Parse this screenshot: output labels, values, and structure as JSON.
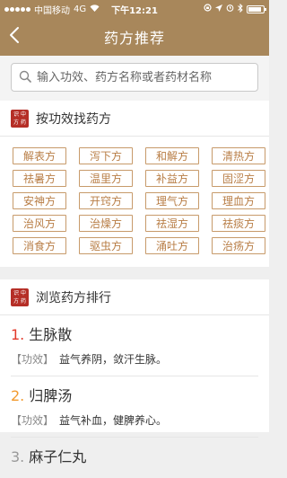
{
  "status_bar": {
    "carrier": "中国移动",
    "network": "4G",
    "time": "下午12:21",
    "battery_level": 0.9
  },
  "nav": {
    "title": "药方推荐",
    "back_icon": "chevron-left-icon"
  },
  "search": {
    "placeholder": "输入功效、药方名称或者药材名称",
    "icon": "search-icon"
  },
  "by_effect": {
    "seal_text": "识中方药",
    "title": "按功效找药方",
    "tags": [
      "解表方",
      "泻下方",
      "和解方",
      "清热方",
      "祛暑方",
      "温里方",
      "补益方",
      "固涩方",
      "安神方",
      "开窍方",
      "理气方",
      "理血方",
      "治风方",
      "治燥方",
      "祛湿方",
      "祛痰方",
      "消食方",
      "驱虫方",
      "涌吐方",
      "治疡方"
    ]
  },
  "ranking": {
    "seal_text": "识中方药",
    "title": "浏览药方排行",
    "items": [
      {
        "num": "1.",
        "name": "生脉散",
        "tag": "【功效】",
        "desc": "益气养阴，敛汗生脉。",
        "num_color": "#e2392b"
      },
      {
        "num": "2.",
        "name": "归脾汤",
        "tag": "【功效】",
        "desc": "益气补血，健脾养心。",
        "num_color": "#f29a2e"
      },
      {
        "num": "3.",
        "name": "麻子仁丸",
        "tag": "",
        "desc": "",
        "num_color": "#999999"
      }
    ]
  },
  "colors": {
    "brand": "#a8875b",
    "tag_border": "#c79a6a",
    "tag_text": "#b87d45",
    "seal": "#b52e26"
  }
}
